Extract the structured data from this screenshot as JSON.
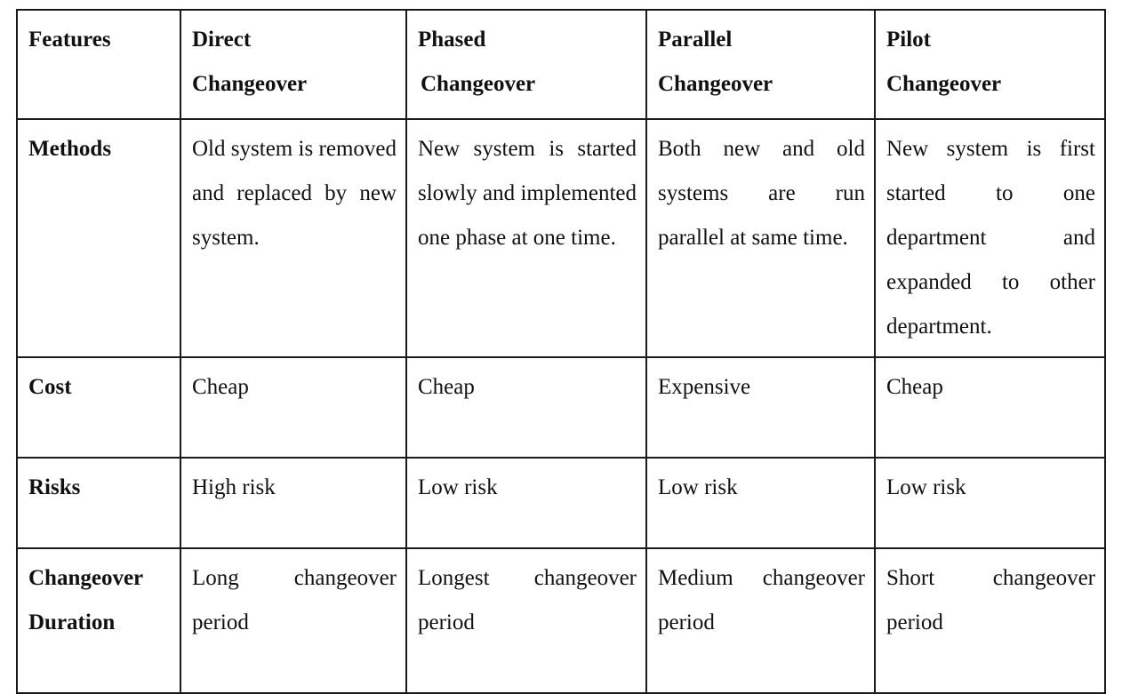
{
  "document": {
    "type": "comparison-table",
    "title": "Changeover Methods Comparison",
    "background_color": "#ffffff",
    "border_color": "#1a1a1a",
    "text_color": "#111111"
  },
  "table": {
    "columns": [
      {
        "key": "features",
        "header_line1": "Features",
        "header_line2": ""
      },
      {
        "key": "direct",
        "header_line1": "Direct",
        "header_line2": "Changeover"
      },
      {
        "key": "phased",
        "header_line1": "Phased",
        "header_line2": "Changeover"
      },
      {
        "key": "parallel",
        "header_line1": "Parallel",
        "header_line2": "Changeover"
      },
      {
        "key": "pilot",
        "header_line1": "Pilot",
        "header_line2": "Changeover"
      }
    ],
    "rows": [
      {
        "label_line1": "Methods",
        "label_line2": "",
        "direct": "Old system is removed and replaced by new system.",
        "phased": "New system is started slowly and implemented one phase at one time.",
        "parallel": "Both new and old systems are run parallel at same time.",
        "pilot": "New system is first started to one department and expanded to other department."
      },
      {
        "label_line1": "Cost",
        "label_line2": "",
        "direct": "Cheap",
        "phased": "Cheap",
        "parallel": "Expensive",
        "pilot": "Cheap"
      },
      {
        "label_line1": "Risks",
        "label_line2": "",
        "direct": "High risk",
        "phased": "Low risk",
        "parallel": "Low risk",
        "pilot": "Low risk"
      },
      {
        "label_line1": "Changeover",
        "label_line2": "Duration",
        "direct": "Long changeover period",
        "phased": "Longest changeover period",
        "parallel": "Medium changeover period",
        "pilot": "Short changeover period"
      }
    ]
  }
}
